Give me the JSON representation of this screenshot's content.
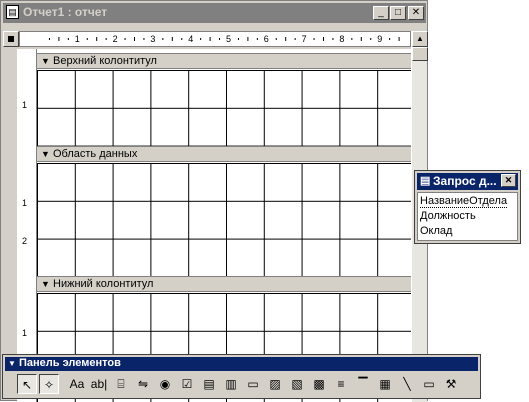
{
  "window": {
    "title": "Отчет1 : отчет",
    "minimize": "_",
    "maximize": "□",
    "close": "✕"
  },
  "ruler": {
    "numbers": [
      "1",
      "2",
      "3",
      "4",
      "5",
      "6",
      "7",
      "8",
      "9"
    ],
    "left_numbers": [
      "1",
      "2"
    ]
  },
  "sections": {
    "page_header": "Верхний колонтитул",
    "detail": "Область данных",
    "page_footer": "Нижний колонтитул"
  },
  "field_list": {
    "title": "Запрос д...",
    "close": "✕",
    "fields": [
      "НазваниеОтдела",
      "Должность",
      "Оклад"
    ]
  },
  "toolbox": {
    "title": "Панель элементов",
    "tools": [
      {
        "icon": "select-objects-icon",
        "glyph": "↖"
      },
      {
        "icon": "control-wizards-icon",
        "glyph": "✧"
      },
      {
        "icon": "label-icon",
        "glyph": "Aa"
      },
      {
        "icon": "text-box-icon",
        "glyph": "ab|"
      },
      {
        "icon": "option-group-icon",
        "glyph": "⌸"
      },
      {
        "icon": "toggle-button-icon",
        "glyph": "⇋"
      },
      {
        "icon": "option-button-icon",
        "glyph": "◉"
      },
      {
        "icon": "check-box-icon",
        "glyph": "☑"
      },
      {
        "icon": "combo-box-icon",
        "glyph": "▤"
      },
      {
        "icon": "list-box-icon",
        "glyph": "▥"
      },
      {
        "icon": "command-button-icon",
        "glyph": "▭"
      },
      {
        "icon": "image-icon",
        "glyph": "▨"
      },
      {
        "icon": "unbound-object-frame-icon",
        "glyph": "▧"
      },
      {
        "icon": "bound-object-frame-icon",
        "glyph": "▩"
      },
      {
        "icon": "page-break-icon",
        "glyph": "≡"
      },
      {
        "icon": "tab-control-icon",
        "glyph": "▔"
      },
      {
        "icon": "subform-icon",
        "glyph": "▦"
      },
      {
        "icon": "line-icon",
        "glyph": "╲"
      },
      {
        "icon": "rectangle-icon",
        "glyph": "▭"
      },
      {
        "icon": "more-controls-icon",
        "glyph": "⚒"
      }
    ]
  }
}
